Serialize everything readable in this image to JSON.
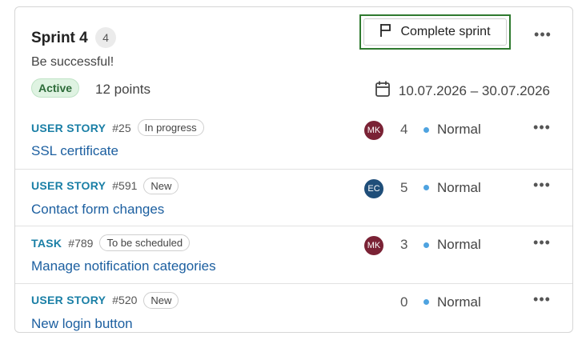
{
  "sprint": {
    "title": "Sprint 4",
    "item_count": "4",
    "description": "Be successful!",
    "status": "Active",
    "points": "12 points",
    "date_range": "10.07.2026 – 30.07.2026",
    "complete_button": "Complete sprint",
    "more_label": "•••"
  },
  "colors": {
    "accent_green": "#2f7a2f",
    "link_blue": "#1c5fa0",
    "type_blue": "#1a7fa6",
    "priority_dot": "#4ea3e0"
  },
  "items": [
    {
      "type": "USER STORY",
      "number": "#25",
      "status": "In progress",
      "title": "SSL certificate",
      "assignee": "MK",
      "assignee_color": "#7a2235",
      "points": "4",
      "priority": "Normal",
      "more": "•••"
    },
    {
      "type": "USER STORY",
      "number": "#591",
      "status": "New",
      "title": "Contact form changes",
      "assignee": "EC",
      "assignee_color": "#1f4e79",
      "points": "5",
      "priority": "Normal",
      "more": "•••"
    },
    {
      "type": "TASK",
      "number": "#789",
      "status": "To be scheduled",
      "title": "Manage notification categories",
      "assignee": "MK",
      "assignee_color": "#7a2235",
      "points": "3",
      "priority": "Normal",
      "more": "•••"
    },
    {
      "type": "USER STORY",
      "number": "#520",
      "status": "New",
      "title": "New login button",
      "assignee": "",
      "assignee_color": "",
      "points": "0",
      "priority": "Normal",
      "more": "•••"
    }
  ]
}
